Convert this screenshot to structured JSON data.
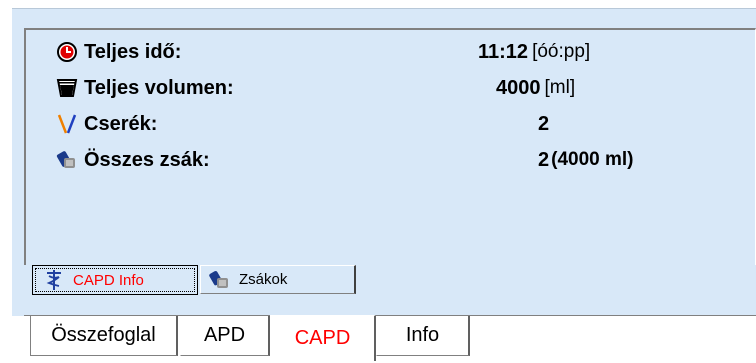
{
  "summary": {
    "rows": [
      {
        "label": "Teljes idő:",
        "value": "11:12",
        "unit": "[óó:pp]",
        "icon": "clock-icon"
      },
      {
        "label": "Teljes volumen:",
        "value": "4000",
        "unit": "[ml]",
        "icon": "container-icon"
      },
      {
        "label": "Cserék:",
        "value": "2",
        "unit": "",
        "icon": "exchange-icon"
      },
      {
        "label": "Összes zsák:",
        "value": "2",
        "unit": "(4000 ml)",
        "icon": "bag-icon"
      }
    ]
  },
  "inner_tabs": [
    {
      "label": "CAPD Info",
      "icon": "caduceus-icon",
      "selected": true
    },
    {
      "label": "Zsákok",
      "icon": "bags-icon",
      "selected": false
    }
  ],
  "bottom_tabs": [
    {
      "label": "Összefoglal",
      "selected": false
    },
    {
      "label": "APD",
      "selected": false
    },
    {
      "label": "CAPD",
      "selected": true
    },
    {
      "label": "Info",
      "selected": false
    }
  ],
  "colors": {
    "panel_bg": "#d8e8f8",
    "active_tab_text": "#ff0000",
    "icon_red": "#e00000",
    "icon_orange": "#f08000",
    "icon_blue": "#2040c0"
  }
}
